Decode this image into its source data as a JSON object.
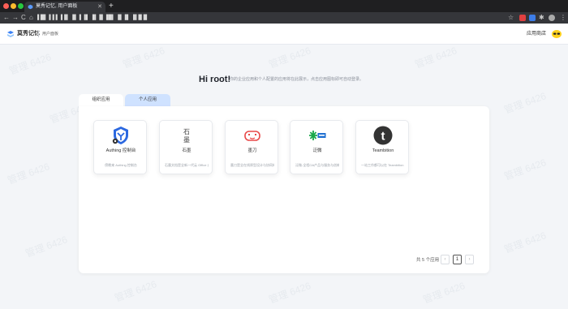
{
  "browser": {
    "tab_title": "莫秀记忆, 用户面板",
    "tab_close": "✕",
    "newtab": "+",
    "back": "←",
    "forward": "→",
    "reload": "C",
    "home": "⌂",
    "address": "▐ █▌▐▐ ▌▐▐▌ ▐▌▐ ▐▌ ▐▌▐▌▐█▌ ▐▌▐▌ ▐▌█▐▌"
  },
  "header": {
    "brand": "莫秀记忆",
    "subtitle": "用户面板",
    "app_store": "应用商店"
  },
  "greeting": {
    "title": "Hi root!",
    "description": "你的企业应用和个人配置的应用将在此展示，点击应用图标即可自动登录。"
  },
  "tabs": [
    {
      "label": "组织应用"
    },
    {
      "label": "个人应用"
    }
  ],
  "apps": [
    {
      "name": "Authing 控制台",
      "desc": "傍晚来 Authing 控制台",
      "icon": "authing-icon"
    },
    {
      "name": "石墨",
      "desc": "石墨文档是全新一代云 Office 办公软件，支...",
      "icon": "shimo-icon"
    },
    {
      "name": "墨刀",
      "desc": "墨刀是全在线原型设计与协同的工具，专业...",
      "icon": "modao-icon"
    },
    {
      "name": "泛微",
      "desc": "泛微-全程OA产品与服务与创新，提供专业...",
      "icon": "weaver-icon"
    },
    {
      "name": "Teambition",
      "desc": "一站工作都可以在 Teambition 中做，无...",
      "icon": "teambition-icon"
    }
  ],
  "logos": {
    "shimo_line1": "石",
    "shimo_line2": "墨",
    "teambition_letter": "t"
  },
  "pagination": {
    "total": "共 5 个应用",
    "prev": "‹",
    "current": "1",
    "next": "›"
  },
  "watermark": "管理 6426",
  "colors": {
    "accent": "#2266ff",
    "tab_inactive": "#cfe2ff",
    "avatar": "#ffd21f"
  }
}
